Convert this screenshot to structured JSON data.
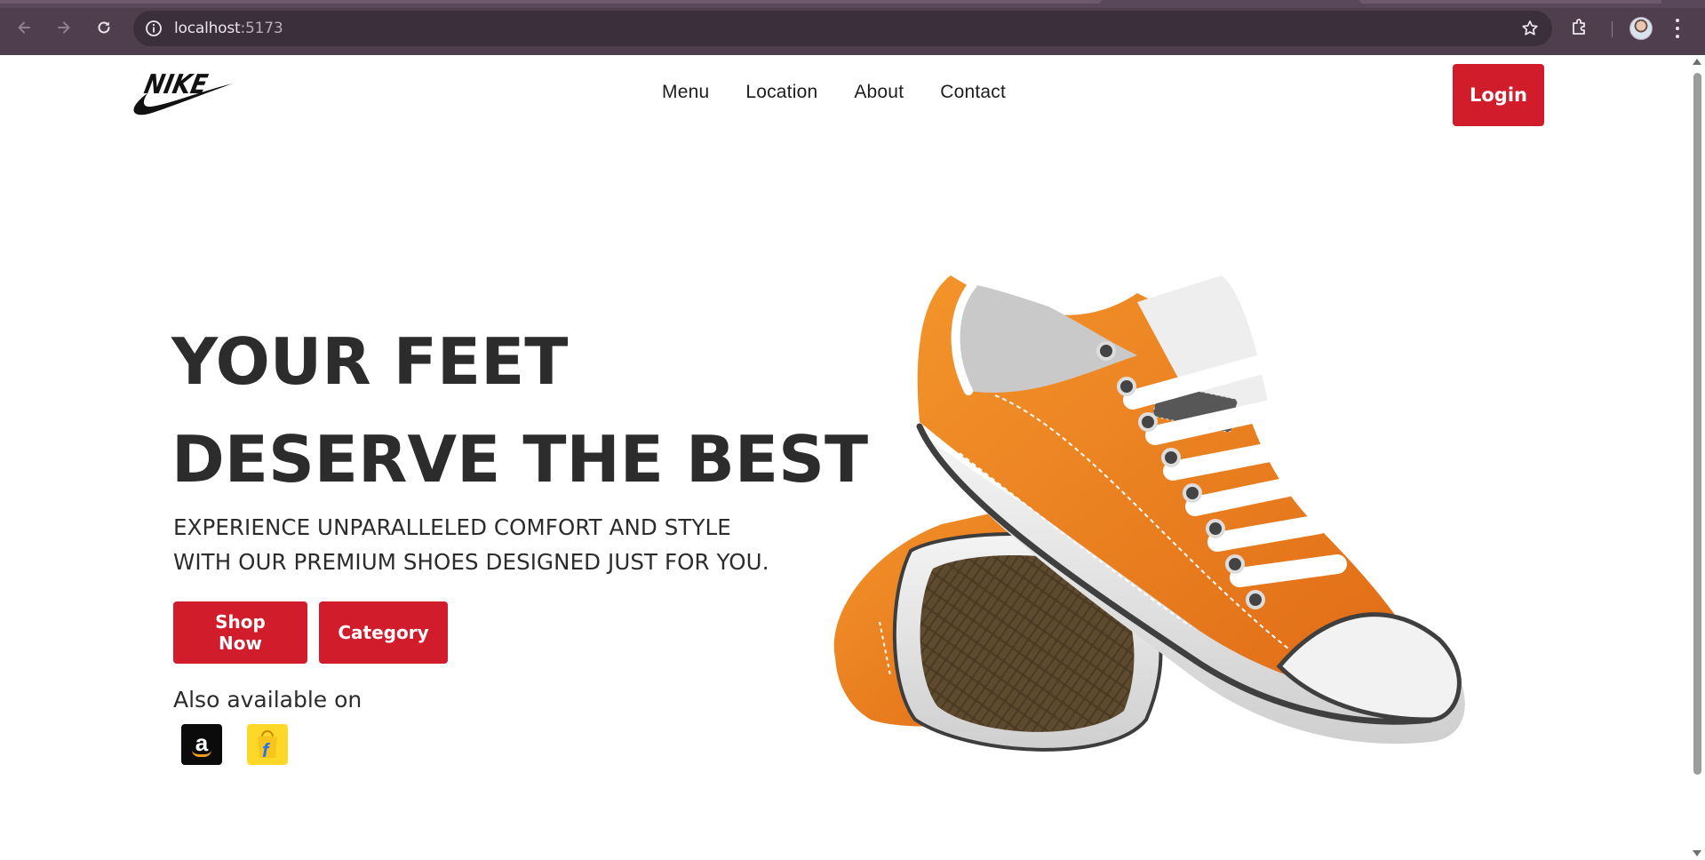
{
  "browser": {
    "url_host": "localhost",
    "url_port": ":5173",
    "icons": [
      "back-arrow-icon",
      "forward-arrow-icon",
      "reload-icon",
      "site-info-icon",
      "bookmark-star-icon",
      "extensions-icon",
      "profile-avatar",
      "more-menu-icon"
    ]
  },
  "header": {
    "logo": "NIKE",
    "menu": [
      "Menu",
      "Location",
      "About",
      "Contact"
    ],
    "login_label": "Login"
  },
  "hero": {
    "title_line1": "YOUR FEET",
    "title_line2": "DESERVE THE BEST",
    "subtitle": "EXPERIENCE UNPARALLELED COMFORT AND STYLE WITH OUR PREMIUM SHOES DESIGNED JUST FOR YOU.",
    "shop_label": "Shop Now",
    "category_label": "Category",
    "available_label": "Also available on",
    "stores": [
      "amazon",
      "flipkart"
    ]
  },
  "colors": {
    "accent": "#d01c2b",
    "chrome": "#4f3f4e",
    "shoe_orange": "#ee8420",
    "text": "#2c2c2c"
  }
}
